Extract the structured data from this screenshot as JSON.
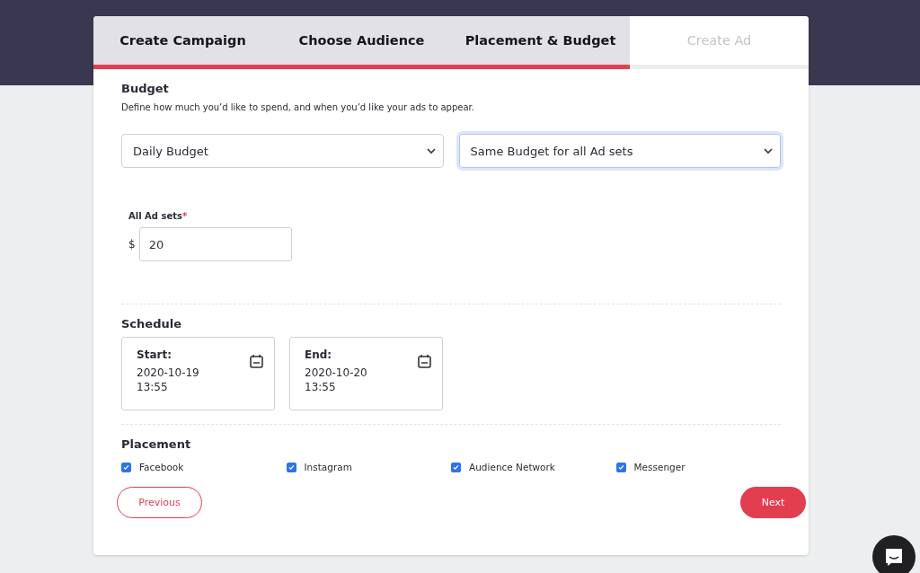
{
  "steps": [
    {
      "label": "Create Campaign",
      "completed": true
    },
    {
      "label": "Choose Audience",
      "completed": true
    },
    {
      "label": "Placement & Budget",
      "completed": true
    },
    {
      "label": "Create Ad",
      "completed": false
    }
  ],
  "budget": {
    "title": "Budget",
    "description": "Define how much you’d like to spend, and when you’d like your ads to appear.",
    "selects": [
      {
        "value": "Daily Budget",
        "focused": false
      },
      {
        "value": "Same Budget for all Ad sets",
        "focused": true
      }
    ],
    "amount": {
      "label": "All Ad sets",
      "required_mark": "*",
      "currency": "$",
      "value": "20"
    }
  },
  "schedule": {
    "title": "Schedule",
    "dates": [
      {
        "label": "Start:",
        "date": "2020-10-19",
        "time": "13:55"
      },
      {
        "label": "End:",
        "date": "2020-10-20",
        "time": "13:55"
      }
    ]
  },
  "placement": {
    "title": "Placement",
    "options": [
      {
        "label": "Facebook",
        "checked": true
      },
      {
        "label": "Instagram",
        "checked": true
      },
      {
        "label": "Audience Network",
        "checked": true
      },
      {
        "label": "Messenger",
        "checked": true
      }
    ]
  },
  "buttons": {
    "previous": "Previous",
    "next": "Next"
  }
}
